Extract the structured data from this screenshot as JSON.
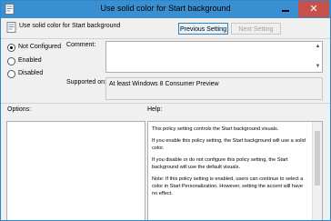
{
  "window": {
    "title": "Use solid color for Start background",
    "close_glyph": "✕"
  },
  "header": {
    "setting_name": "Use solid color for Start background",
    "previous_button": "Previous Setting",
    "next_button": "Next Setting"
  },
  "state_options": [
    {
      "label": "Not Configured",
      "checked": true
    },
    {
      "label": "Enabled",
      "checked": false
    },
    {
      "label": "Disabled",
      "checked": false
    }
  ],
  "comment": {
    "label": "Comment:",
    "value": ""
  },
  "supported": {
    "label": "Supported on:",
    "value": "At least Windows 8 Consumer Preview"
  },
  "options": {
    "label": "Options:"
  },
  "help": {
    "label": "Help:",
    "paragraphs": [
      "This policy setting controls the Start background visuals.",
      "If you enable this policy setting, the Start background will use a solid color.",
      "If you disable or do not configure this policy setting, the Start background will use the default visuals.",
      "Note: If this policy setting is enabled, users can continue to select a color in Start Personalization. However, setting the accent will have no effect."
    ]
  },
  "colors": {
    "titlebar": "#3a8fd0",
    "close_button": "#c7504a"
  },
  "icons": {
    "title": "policy-setting-icon",
    "header": "policy-setting-icon",
    "minimize": "minimize-icon",
    "close": "close-icon"
  }
}
